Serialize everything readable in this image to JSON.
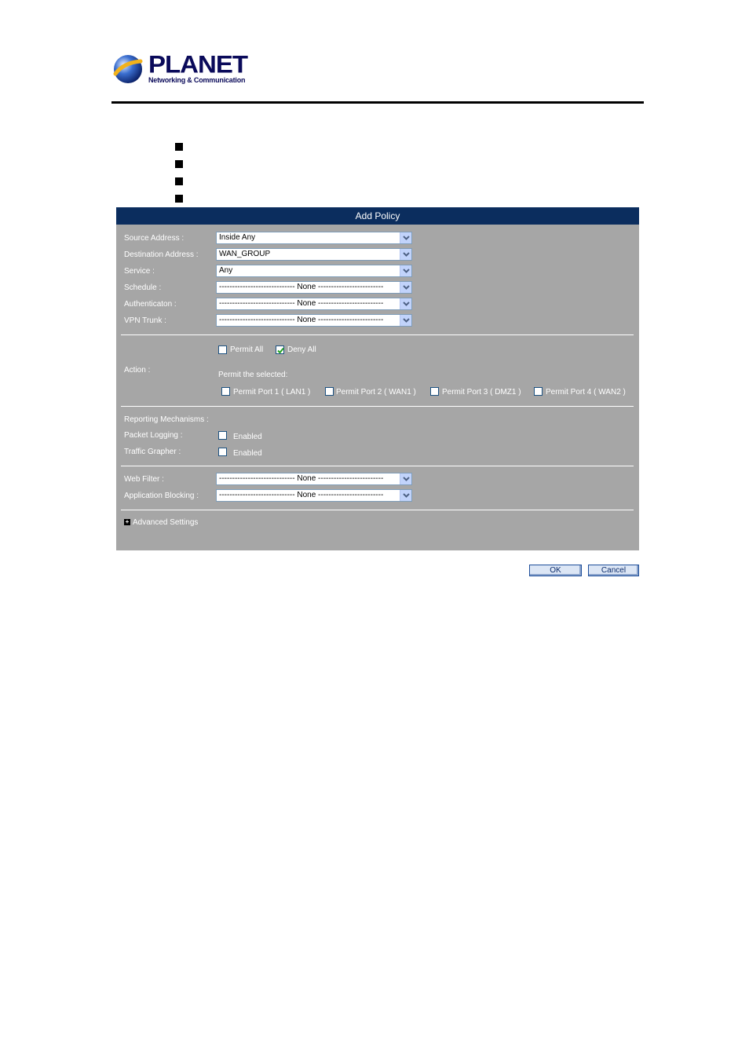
{
  "brand": {
    "name": "PLANET",
    "tagline": "Networking & Communication"
  },
  "panel": {
    "title": "Add Policy",
    "fields": [
      {
        "label": "Source Address :",
        "value": "Inside Any"
      },
      {
        "label": "Destination Address :",
        "value": "WAN_GROUP"
      },
      {
        "label": "Service :",
        "value": "Any"
      },
      {
        "label": "Schedule :",
        "value": "----------------------------- None -------------------------"
      },
      {
        "label": "Authenticaton :",
        "value": "----------------------------- None -------------------------"
      },
      {
        "label": "VPN Trunk :",
        "value": "----------------------------- None -------------------------"
      }
    ],
    "action": {
      "label": "Action :",
      "permit_all": {
        "label": "Permit All",
        "checked": false
      },
      "deny_all": {
        "label": "Deny All",
        "checked": true
      },
      "permit_selected_label": "Permit the selected:",
      "ports": [
        {
          "label": "Permit Port 1 ( LAN1 )",
          "checked": false
        },
        {
          "label": "Permit Port 2 ( WAN1 )",
          "checked": false
        },
        {
          "label": "Permit Port 3 ( DMZ1 )",
          "checked": false
        },
        {
          "label": "Permit Port 4 ( WAN2 )",
          "checked": false
        }
      ]
    },
    "reporting": {
      "heading": "Reporting Mechanisms :",
      "packet_logging": {
        "label": "Packet Logging :",
        "option": "Enabled",
        "checked": false
      },
      "traffic_grapher": {
        "label": "Traffic Grapher :",
        "option": "Enabled",
        "checked": false
      }
    },
    "filters": [
      {
        "label": "Web Filter :",
        "value": "----------------------------- None -------------------------"
      },
      {
        "label": "Application Blocking :",
        "value": "----------------------------- None -------------------------"
      }
    ],
    "advanced": {
      "icon": "+",
      "label": "Advanced Settings"
    }
  },
  "buttons": {
    "ok": "OK",
    "cancel": "Cancel"
  },
  "colors": {
    "panel_bg": "#a6a6a6",
    "title_bg": "#0b2d5e",
    "check": "#21a121"
  }
}
